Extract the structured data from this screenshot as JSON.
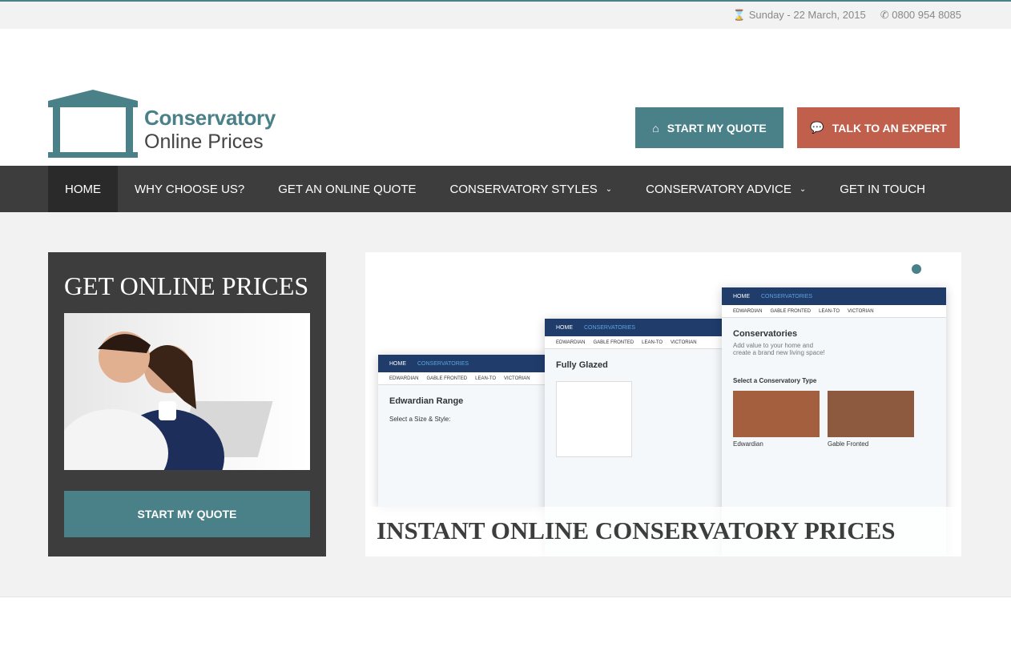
{
  "topbar": {
    "date": "Sunday - 22 March, 2015",
    "phone": "0800 954 8085",
    "date_icon": "hourglass-icon",
    "phone_icon": "phone-icon"
  },
  "logo": {
    "line1": "Conservatory",
    "line2": "Online Prices"
  },
  "header": {
    "quote_button": "START MY QUOTE",
    "expert_button": "TALK TO AN EXPERT"
  },
  "nav": {
    "items": [
      {
        "label": "HOME"
      },
      {
        "label": "WHY CHOOSE US?"
      },
      {
        "label": "GET AN ONLINE QUOTE"
      },
      {
        "label": "CONSERVATORY STYLES"
      },
      {
        "label": "CONSERVATORY ADVICE"
      },
      {
        "label": "GET IN TOUCH"
      }
    ]
  },
  "promo": {
    "title": "GET ONLINE PRICES",
    "button": "START MY QUOTE"
  },
  "slider": {
    "caption": "INSTANT ONLINE CONSERVATORY PRICES",
    "mock": {
      "home": "HOME",
      "cons": "CONSERVATORIES",
      "tabs": [
        "EDWARDIAN",
        "GABLE FRONTED",
        "LEAN-TO",
        "VICTORIAN"
      ],
      "m1_title": "Edwardian Range",
      "m1_sub": "Select a Size & Style:",
      "m2_title": "Fully Glazed",
      "m3_title": "Conservatories",
      "m3_text": "Add value to your home and create a brand new living space!",
      "m3_sub": "Select a Conservatory Type",
      "m3_a": "Edwardian",
      "m3_b": "Gable Fronted"
    }
  },
  "colors": {
    "accent": "#4a8088",
    "expert": "#c0604c",
    "nav": "#3d3d3d"
  }
}
